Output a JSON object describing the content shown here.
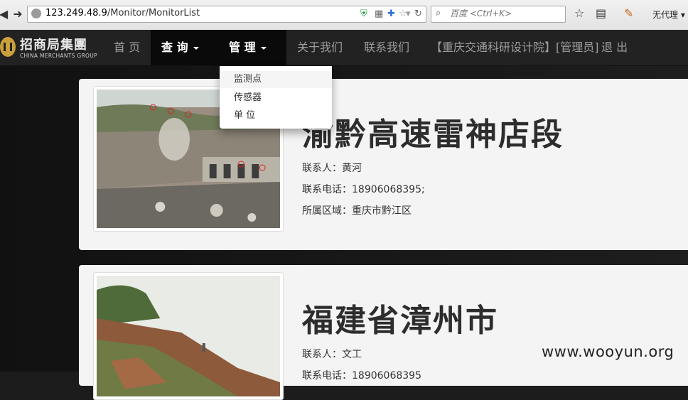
{
  "browser": {
    "url_host": "123.249.48.9",
    "url_path": "/Monitor/MonitorList",
    "search_placeholder": "百度 <Ctrl+K>",
    "proxy_label": "无代理"
  },
  "site": {
    "logo_cn": "招商局集團",
    "logo_en": "CHINA MERCHANTS GROUP",
    "nav": {
      "home": "首 页",
      "query": "查 询",
      "manage": "管 理",
      "about": "关于我们",
      "contact": "联系我们",
      "user_info": "【重庆交通科研设计院】[管理员]",
      "logout": "退 出"
    },
    "dropdown": [
      "监测点",
      "传感器",
      "单 位"
    ]
  },
  "cards": [
    {
      "title": "渝黔高速雷神店段",
      "contact_label": "联系人：",
      "contact": "黄河",
      "phone_label": "联系电话：",
      "phone": "18906068395;",
      "region_label": "所属区域：",
      "region": "重庆市黔江区"
    },
    {
      "title": "福建省漳州市",
      "contact_label": "联系人：",
      "contact": "文工",
      "phone_label": "联系电话：",
      "phone": "18906068395"
    }
  ],
  "watermark": "www.wooyun.org",
  "colors": {
    "navbar_bg": "#222222",
    "navbar_active": "#0a0a0a",
    "nav_text": "#9d9d9d",
    "card_bg": "#f4f4f4"
  }
}
